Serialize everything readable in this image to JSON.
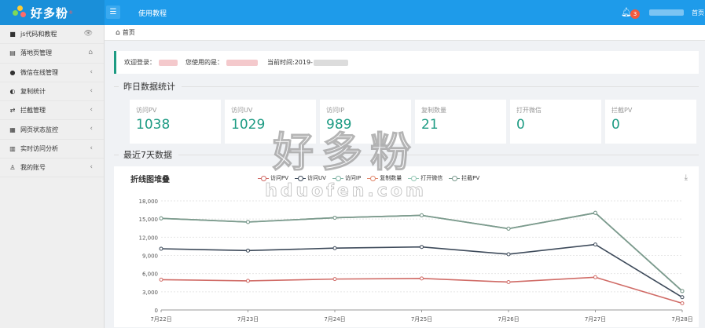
{
  "header": {
    "logo_text": "好多粉",
    "logo_sup": "®",
    "menu_icon": "hamburger-icon",
    "title": "使用教程",
    "notification_count": "3",
    "home_label": "首页"
  },
  "sidebar": {
    "items": [
      {
        "label": "js代码和教程",
        "icon": "bookmark-icon",
        "glyph": "■",
        "arrow": "👁"
      },
      {
        "label": "落地页管理",
        "icon": "document-icon",
        "glyph": "▤",
        "arrow": "⌂"
      },
      {
        "label": "微信在线管理",
        "icon": "wechat-icon",
        "glyph": "●",
        "arrow": "‹"
      },
      {
        "label": "复制统计",
        "icon": "pie-icon",
        "glyph": "◐",
        "arrow": "‹"
      },
      {
        "label": "拦截管理",
        "icon": "swap-icon",
        "glyph": "⇄",
        "arrow": "‹"
      },
      {
        "label": "网页状态监控",
        "icon": "table-icon",
        "glyph": "▦",
        "arrow": "‹"
      },
      {
        "label": "实时访问分析",
        "icon": "bar-chart-icon",
        "glyph": "▥",
        "arrow": "‹"
      },
      {
        "label": "我的账号",
        "icon": "user-icon",
        "glyph": "♙",
        "arrow": "‹"
      }
    ]
  },
  "breadcrumb": {
    "icon": "home-icon",
    "label": "首页"
  },
  "welcome": {
    "prefix": "欢迎登录：",
    "using": "您使用的是：",
    "time_label": "当前时间:2019-"
  },
  "yesterday": {
    "title": "昨日数据统计",
    "stats": [
      {
        "label": "访问PV",
        "value": "1038"
      },
      {
        "label": "访问UV",
        "value": "1029"
      },
      {
        "label": "访问IP",
        "value": "989"
      },
      {
        "label": "复制数量",
        "value": "21"
      },
      {
        "label": "打开微信",
        "value": "0"
      },
      {
        "label": "拦截PV",
        "value": "0"
      }
    ]
  },
  "week": {
    "title": "最近7天数据"
  },
  "watermark": {
    "text": "好多粉",
    "url": "hduofen.com"
  },
  "chart_data": {
    "type": "line",
    "title": "折线图堆叠",
    "download_icon": "download-icon",
    "categories": [
      "7月22日",
      "7月23日",
      "7月24日",
      "7月25日",
      "7月26日",
      "7月27日",
      "7月28日"
    ],
    "ylim": [
      0,
      18000
    ],
    "yticks": [
      "0",
      "3,000",
      "6,000",
      "9,000",
      "12,000",
      "15,000",
      "18,000"
    ],
    "grid": true,
    "legend_position": "top",
    "series": [
      {
        "name": "访问PV",
        "color": "#d06b66",
        "values": [
          5000,
          4800,
          5100,
          5200,
          4600,
          5400,
          1100
        ]
      },
      {
        "name": "访问UV",
        "color": "#3d4a5a",
        "values": [
          10100,
          9800,
          10200,
          10400,
          9200,
          10800,
          2100
        ]
      },
      {
        "name": "访问IP",
        "color": "#7fb2a4",
        "values": [
          15100,
          14500,
          15200,
          15600,
          13400,
          16000,
          3100
        ]
      },
      {
        "name": "复制数量",
        "color": "#e0876b",
        "values": [
          15120,
          14520,
          15220,
          15620,
          13420,
          16020,
          3120
        ]
      },
      {
        "name": "打开微信",
        "color": "#93c7b4",
        "values": [
          15120,
          14520,
          15220,
          15620,
          13420,
          16020,
          3120
        ]
      },
      {
        "name": "拦截PV",
        "color": "#7a9a8e",
        "values": [
          15120,
          14520,
          15220,
          15620,
          13420,
          16020,
          3120
        ]
      }
    ]
  }
}
